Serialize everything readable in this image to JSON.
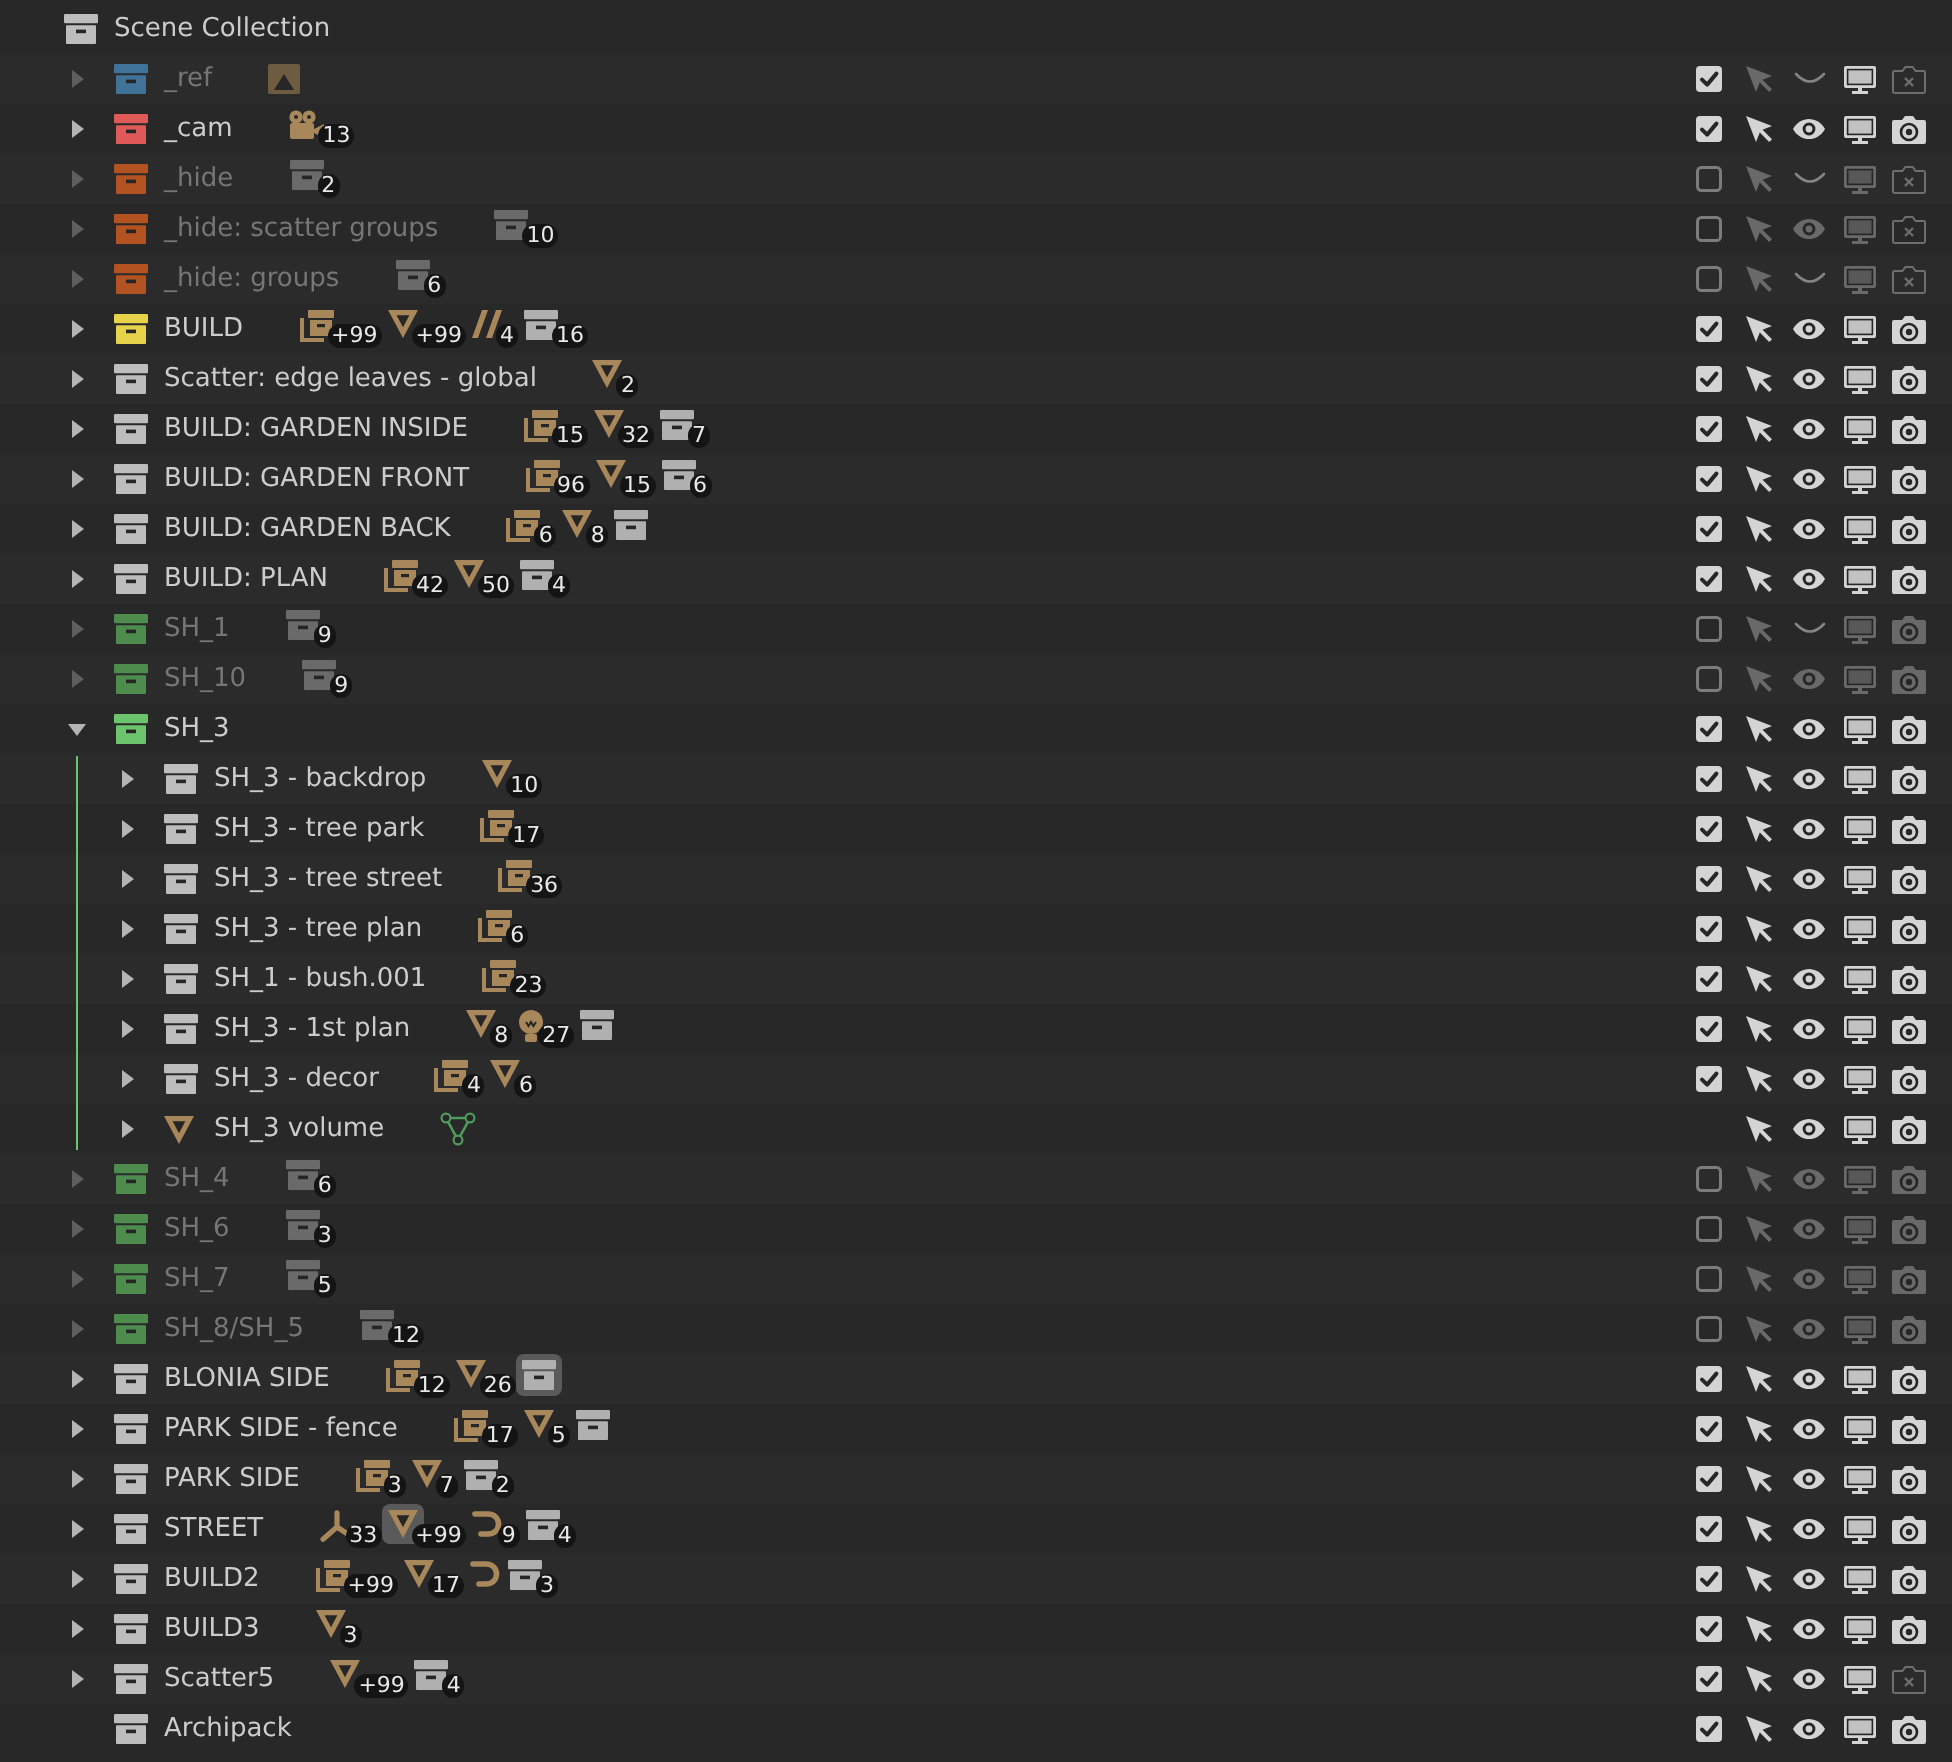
{
  "outliner": {
    "root": {
      "kind": "collection",
      "name": "Scene Collection",
      "children": [
        {
          "kind": "collection",
          "name": "_ref",
          "color": "#3f7398",
          "expanded": false,
          "checked": true,
          "visible": false,
          "renderable": false,
          "contents": [
            {
              "kind": "image",
              "active": false
            }
          ]
        },
        {
          "kind": "collection",
          "name": "_cam",
          "color": "#e05a5a",
          "expanded": false,
          "checked": true,
          "visible": true,
          "renderable": true,
          "contents": [
            {
              "kind": "camera",
              "count": "13",
              "active": false
            }
          ]
        },
        {
          "kind": "collection",
          "name": "_hide",
          "color": "#b35322",
          "expanded": false,
          "checked": false,
          "visible": false,
          "renderable": false,
          "contents": [
            {
              "kind": "collection",
              "count": "2",
              "active": false
            }
          ]
        },
        {
          "kind": "collection",
          "name": "_hide: scatter groups",
          "color": "#b35322",
          "expanded": false,
          "checked": false,
          "visible": true,
          "renderable": false,
          "contents": [
            {
              "kind": "collection",
              "count": "10",
              "active": false
            }
          ]
        },
        {
          "kind": "collection",
          "name": "_hide: groups",
          "color": "#b35322",
          "expanded": false,
          "checked": false,
          "visible": false,
          "renderable": false,
          "contents": [
            {
              "kind": "collection",
              "count": "6",
              "active": false
            }
          ]
        },
        {
          "kind": "collection",
          "name": "BUILD",
          "color": "#e6d34a",
          "expanded": false,
          "checked": true,
          "visible": true,
          "renderable": true,
          "contents": [
            {
              "kind": "instance",
              "count": "+99",
              "active": false
            },
            {
              "kind": "mesh",
              "count": "+99",
              "active": false
            },
            {
              "kind": "strands",
              "count": "4",
              "active": false
            },
            {
              "kind": "collection",
              "count": "16",
              "active": false
            }
          ]
        },
        {
          "kind": "collection",
          "name": "Scatter: edge leaves - global",
          "color": "#bdbdbd",
          "expanded": false,
          "checked": true,
          "visible": true,
          "renderable": true,
          "contents": [
            {
              "kind": "mesh",
              "count": "2",
              "active": false
            }
          ]
        },
        {
          "kind": "collection",
          "name": "BUILD: GARDEN INSIDE",
          "color": "#bdbdbd",
          "expanded": false,
          "checked": true,
          "visible": true,
          "renderable": true,
          "contents": [
            {
              "kind": "instance",
              "count": "15",
              "active": false
            },
            {
              "kind": "mesh",
              "count": "32",
              "active": false
            },
            {
              "kind": "collection",
              "count": "7",
              "active": false
            }
          ]
        },
        {
          "kind": "collection",
          "name": "BUILD: GARDEN FRONT",
          "color": "#bdbdbd",
          "expanded": false,
          "checked": true,
          "visible": true,
          "renderable": true,
          "contents": [
            {
              "kind": "instance",
              "count": "96",
              "active": false
            },
            {
              "kind": "mesh",
              "count": "15",
              "active": false
            },
            {
              "kind": "collection",
              "count": "6",
              "active": false
            }
          ]
        },
        {
          "kind": "collection",
          "name": "BUILD: GARDEN BACK",
          "color": "#bdbdbd",
          "expanded": false,
          "checked": true,
          "visible": true,
          "renderable": true,
          "contents": [
            {
              "kind": "instance",
              "count": "6",
              "active": false
            },
            {
              "kind": "mesh",
              "count": "8",
              "active": false
            },
            {
              "kind": "collection",
              "active": false
            }
          ]
        },
        {
          "kind": "collection",
          "name": "BUILD: PLAN",
          "color": "#bdbdbd",
          "expanded": false,
          "checked": true,
          "visible": true,
          "renderable": true,
          "contents": [
            {
              "kind": "instance",
              "count": "42",
              "active": false
            },
            {
              "kind": "mesh",
              "count": "50",
              "active": false
            },
            {
              "kind": "collection",
              "count": "4",
              "active": false
            }
          ]
        },
        {
          "kind": "collection",
          "name": "SH_1",
          "color": "#4d8c4d",
          "expanded": false,
          "checked": false,
          "visible": false,
          "renderable": true,
          "contents": [
            {
              "kind": "collection",
              "count": "9",
              "active": false
            }
          ]
        },
        {
          "kind": "collection",
          "name": "SH_10",
          "color": "#4d8c4d",
          "expanded": false,
          "checked": false,
          "visible": true,
          "renderable": true,
          "contents": [
            {
              "kind": "collection",
              "count": "9",
              "active": false
            }
          ]
        },
        {
          "kind": "collection",
          "name": "SH_3",
          "color": "#6cc46c",
          "expanded": true,
          "checked": true,
          "visible": true,
          "renderable": true,
          "children": [
            {
              "kind": "collection",
              "name": "SH_3 - backdrop",
              "color": "#bdbdbd",
              "expanded": false,
              "checked": true,
              "visible": true,
              "renderable": true,
              "contents": [
                {
                  "kind": "mesh",
                  "count": "10",
                  "active": false
                }
              ]
            },
            {
              "kind": "collection",
              "name": "SH_3 - tree park",
              "color": "#bdbdbd",
              "expanded": false,
              "checked": true,
              "visible": true,
              "renderable": true,
              "contents": [
                {
                  "kind": "instance",
                  "count": "17",
                  "active": false
                }
              ]
            },
            {
              "kind": "collection",
              "name": "SH_3 - tree street",
              "color": "#bdbdbd",
              "expanded": false,
              "checked": true,
              "visible": true,
              "renderable": true,
              "contents": [
                {
                  "kind": "instance",
                  "count": "36",
                  "active": false
                }
              ]
            },
            {
              "kind": "collection",
              "name": "SH_3 - tree plan",
              "color": "#bdbdbd",
              "expanded": false,
              "checked": true,
              "visible": true,
              "renderable": true,
              "contents": [
                {
                  "kind": "instance",
                  "count": "6",
                  "active": false
                }
              ]
            },
            {
              "kind": "collection",
              "name": "SH_1 - bush.001",
              "color": "#bdbdbd",
              "expanded": false,
              "checked": true,
              "visible": true,
              "renderable": true,
              "contents": [
                {
                  "kind": "instance",
                  "count": "23",
                  "active": false
                }
              ]
            },
            {
              "kind": "collection",
              "name": "SH_3 - 1st plan",
              "color": "#bdbdbd",
              "expanded": false,
              "checked": true,
              "visible": true,
              "renderable": true,
              "contents": [
                {
                  "kind": "mesh",
                  "count": "8",
                  "active": false
                },
                {
                  "kind": "light",
                  "count": "27",
                  "active": false
                },
                {
                  "kind": "collection",
                  "active": false
                }
              ]
            },
            {
              "kind": "collection",
              "name": "SH_3 - decor",
              "color": "#bdbdbd",
              "expanded": false,
              "checked": true,
              "visible": true,
              "renderable": true,
              "contents": [
                {
                  "kind": "instance",
                  "count": "4",
                  "active": false
                },
                {
                  "kind": "mesh",
                  "count": "6",
                  "active": false
                }
              ]
            },
            {
              "kind": "object",
              "name": "SH_3 volume",
              "expanded": false,
              "visible": true,
              "renderable": true,
              "contents": [
                {
                  "kind": "meshdata",
                  "active": false
                }
              ]
            }
          ]
        },
        {
          "kind": "collection",
          "name": "SH_4",
          "color": "#4d8c4d",
          "expanded": false,
          "checked": false,
          "visible": true,
          "renderable": true,
          "contents": [
            {
              "kind": "collection",
              "count": "6",
              "active": false
            }
          ]
        },
        {
          "kind": "collection",
          "name": "SH_6",
          "color": "#4d8c4d",
          "expanded": false,
          "checked": false,
          "visible": true,
          "renderable": true,
          "contents": [
            {
              "kind": "collection",
              "count": "3",
              "active": false
            }
          ]
        },
        {
          "kind": "collection",
          "name": "SH_7",
          "color": "#4d8c4d",
          "expanded": false,
          "checked": false,
          "visible": true,
          "renderable": true,
          "contents": [
            {
              "kind": "collection",
              "count": "5",
              "active": false
            }
          ]
        },
        {
          "kind": "collection",
          "name": "SH_8/SH_5",
          "color": "#4d8c4d",
          "expanded": false,
          "checked": false,
          "visible": true,
          "renderable": true,
          "contents": [
            {
              "kind": "collection",
              "count": "12",
              "active": false
            }
          ]
        },
        {
          "kind": "collection",
          "name": "BLONIA SIDE",
          "color": "#bdbdbd",
          "expanded": false,
          "checked": true,
          "visible": true,
          "renderable": true,
          "contents": [
            {
              "kind": "instance",
              "count": "12",
              "active": false
            },
            {
              "kind": "mesh",
              "count": "26",
              "active": false
            },
            {
              "kind": "collection",
              "active": true
            }
          ]
        },
        {
          "kind": "collection",
          "name": "PARK SIDE - fence",
          "color": "#bdbdbd",
          "expanded": false,
          "checked": true,
          "visible": true,
          "renderable": true,
          "contents": [
            {
              "kind": "instance",
              "count": "17",
              "active": false
            },
            {
              "kind": "mesh",
              "count": "5",
              "active": false
            },
            {
              "kind": "collection",
              "active": false
            }
          ]
        },
        {
          "kind": "collection",
          "name": "PARK SIDE",
          "color": "#bdbdbd",
          "expanded": false,
          "checked": true,
          "visible": true,
          "renderable": true,
          "contents": [
            {
              "kind": "instance",
              "count": "3",
              "active": false
            },
            {
              "kind": "mesh",
              "count": "7",
              "active": false
            },
            {
              "kind": "collection",
              "count": "2",
              "active": false
            }
          ]
        },
        {
          "kind": "collection",
          "name": "STREET",
          "color": "#bdbdbd",
          "expanded": false,
          "checked": true,
          "visible": true,
          "renderable": true,
          "contents": [
            {
              "kind": "empty",
              "count": "33",
              "active": false
            },
            {
              "kind": "mesh",
              "count": "+99",
              "active": true
            },
            {
              "kind": "curve",
              "count": "9",
              "active": false
            },
            {
              "kind": "collection",
              "count": "4",
              "active": false
            }
          ]
        },
        {
          "kind": "collection",
          "name": "BUILD2",
          "color": "#bdbdbd",
          "expanded": false,
          "checked": true,
          "visible": true,
          "renderable": true,
          "contents": [
            {
              "kind": "instance",
              "count": "+99",
              "active": false
            },
            {
              "kind": "mesh",
              "count": "17",
              "active": false
            },
            {
              "kind": "curve",
              "active": false
            },
            {
              "kind": "collection",
              "count": "3",
              "active": false
            }
          ]
        },
        {
          "kind": "collection",
          "name": "BUILD3",
          "color": "#bdbdbd",
          "expanded": false,
          "checked": true,
          "visible": true,
          "renderable": true,
          "contents": [
            {
              "kind": "mesh",
              "count": "3",
              "active": false
            }
          ]
        },
        {
          "kind": "collection",
          "name": "Scatter5",
          "color": "#bdbdbd",
          "expanded": false,
          "checked": true,
          "visible": true,
          "renderable": false,
          "contents": [
            {
              "kind": "mesh",
              "count": "+99",
              "active": false
            },
            {
              "kind": "collection",
              "count": "4",
              "active": false
            }
          ]
        },
        {
          "kind": "collection",
          "name": "Archipack",
          "color": "#bdbdbd",
          "checked": true,
          "visible": true,
          "renderable": true
        }
      ]
    }
  }
}
